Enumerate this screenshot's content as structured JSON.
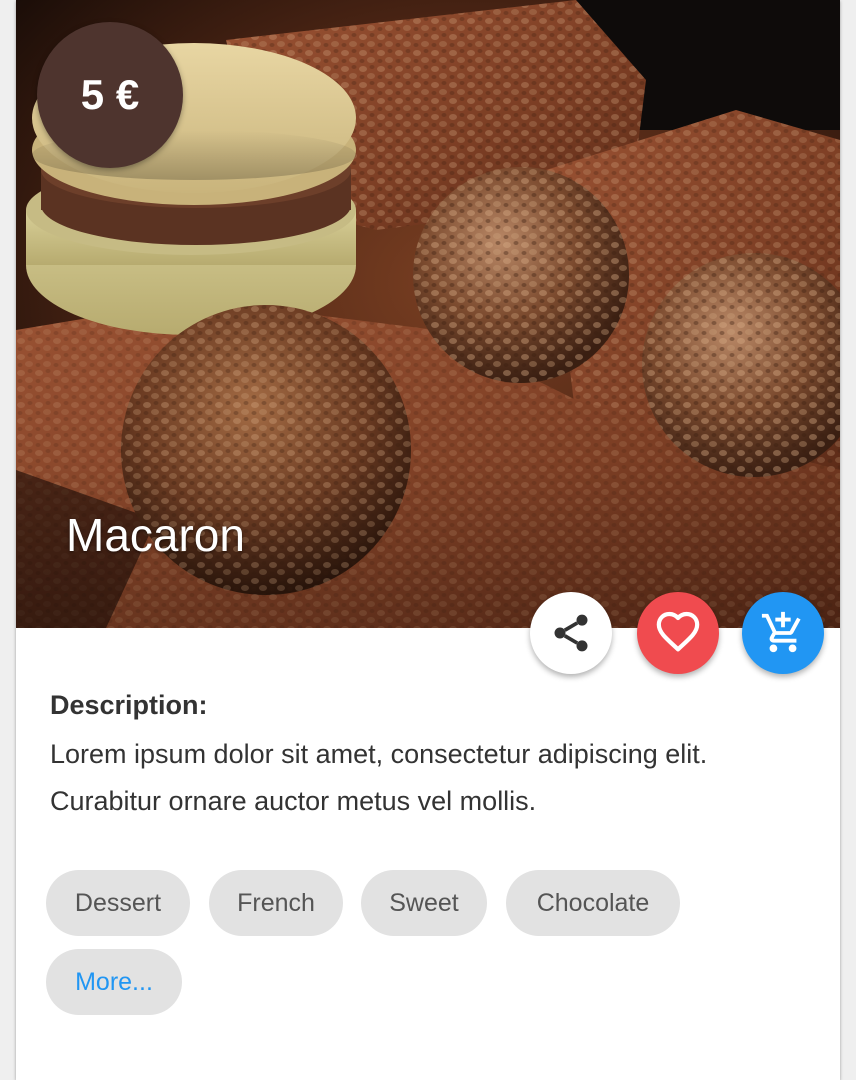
{
  "product": {
    "price": "5 €",
    "title": "Macaron",
    "image_subject": "macarons-and-chocolate-photo"
  },
  "actions": {
    "share_icon": "share-icon",
    "favorite_icon": "heart-icon",
    "cart_icon": "add-shopping-cart-icon"
  },
  "description": {
    "label": "Description:",
    "text": "Lorem ipsum dolor sit amet, consectetur adipiscing elit. Curabitur ornare auctor metus vel mollis."
  },
  "tags": [
    "Dessert",
    "French",
    "Sweet",
    "Chocolate"
  ],
  "more_label": "More...",
  "colors": {
    "price_badge": "#4e342e",
    "favorite": "#f04b4f",
    "cart": "#2196f3",
    "link": "#2196f3",
    "chip_bg": "#e2e2e2"
  }
}
